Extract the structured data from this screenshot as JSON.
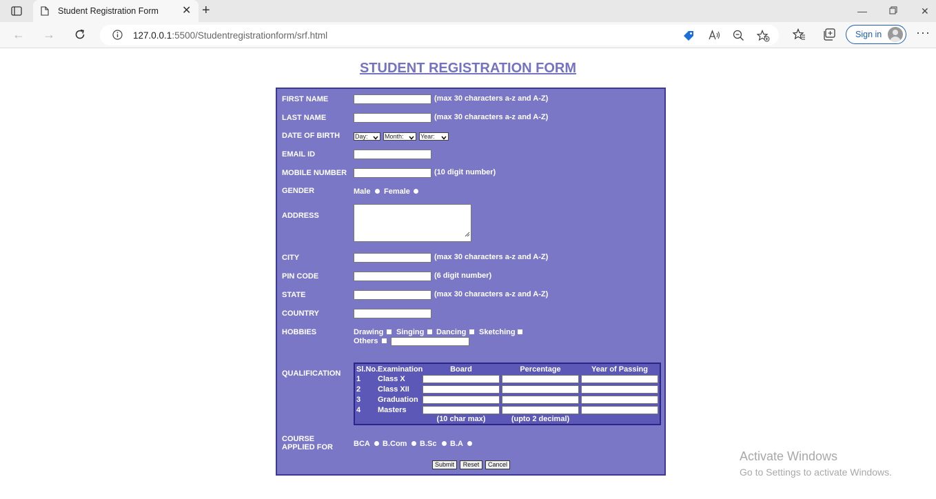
{
  "browser": {
    "tab_title": "Student Registration Form",
    "url_host": "127.0.0.1",
    "url_rest": ":5500/Studentregistrationform/srf.html",
    "signin_label": "Sign in"
  },
  "page": {
    "title": "STUDENT REGISTRATION FORM"
  },
  "form": {
    "first_name": {
      "label": "FIRST NAME",
      "hint": "(max 30 characters a-z and A-Z)",
      "value": ""
    },
    "last_name": {
      "label": "LAST NAME",
      "hint": "(max 30 characters a-z and A-Z)",
      "value": ""
    },
    "dob": {
      "label": "DATE OF BIRTH",
      "day": "Day:",
      "month": "Month:",
      "year": "Year:"
    },
    "email": {
      "label": "EMAIL ID",
      "value": ""
    },
    "mobile": {
      "label": "MOBILE NUMBER",
      "hint": "(10 digit number)",
      "value": ""
    },
    "gender": {
      "label": "GENDER",
      "options": [
        "Male",
        "Female"
      ]
    },
    "address": {
      "label": "ADDRESS",
      "value": ""
    },
    "city": {
      "label": "CITY",
      "hint": "(max 30 characters a-z and A-Z)",
      "value": ""
    },
    "pin": {
      "label": "PIN CODE",
      "hint": "(6 digit number)",
      "value": ""
    },
    "state": {
      "label": "STATE",
      "hint": "(max 30 characters a-z and A-Z)",
      "value": ""
    },
    "country": {
      "label": "COUNTRY",
      "value": ""
    },
    "hobbies": {
      "label": "HOBBIES",
      "options": [
        "Drawing",
        "Singing",
        "Dancing",
        "Sketching",
        "Others"
      ]
    },
    "qualification": {
      "label": "QUALIFICATION",
      "headers": [
        "Sl.No.",
        "Examination",
        "Board",
        "Percentage",
        "Year of Passing"
      ],
      "rows": [
        {
          "no": "1",
          "exam": "Class X"
        },
        {
          "no": "2",
          "exam": "Class XII"
        },
        {
          "no": "3",
          "exam": "Graduation"
        },
        {
          "no": "4",
          "exam": "Masters"
        }
      ],
      "footer_board": "(10 char max)",
      "footer_percentage": "(upto 2 decimal)"
    },
    "course": {
      "label_line1": "COURSE",
      "label_line2": "APPLIED FOR",
      "options": [
        "BCA",
        "B.Com",
        "B.Sc",
        "B.A"
      ]
    },
    "buttons": {
      "submit": "Submit",
      "reset": "Reset",
      "cancel": "Cancel"
    }
  },
  "watermark": {
    "title": "Activate Windows",
    "subtitle": "Go to Settings to activate Windows."
  }
}
